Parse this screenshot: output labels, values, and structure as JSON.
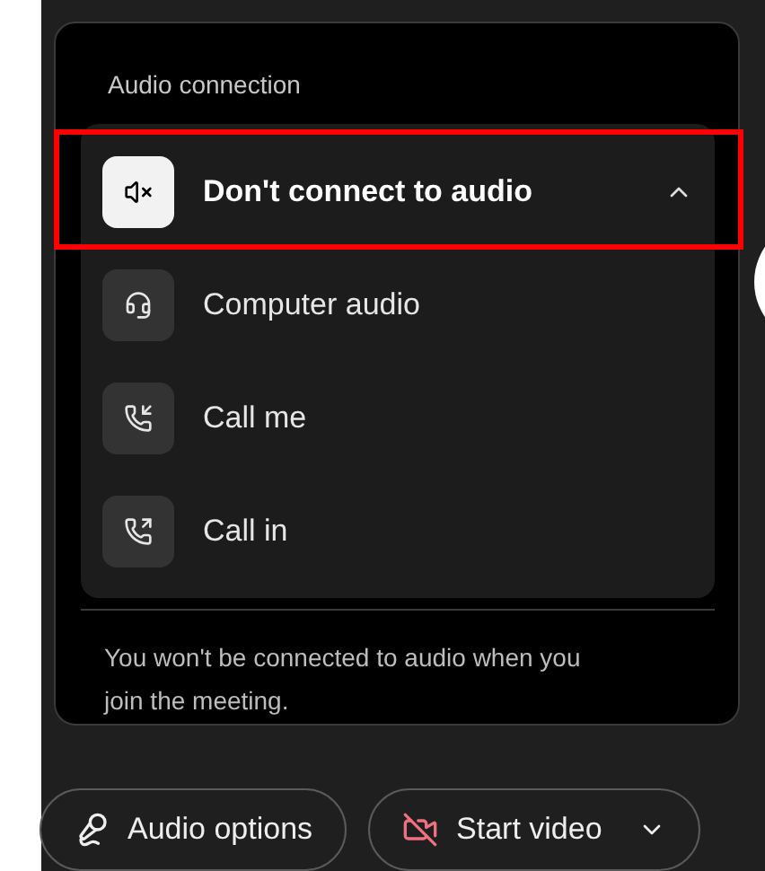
{
  "audio_connection": {
    "heading": "Audio connection",
    "expanded": true,
    "options": [
      {
        "kind": "mute",
        "label": "Don't connect to audio",
        "selected": true
      },
      {
        "kind": "headset",
        "label": "Computer audio",
        "selected": false
      },
      {
        "kind": "call_me",
        "label": "Call me",
        "selected": false
      },
      {
        "kind": "call_in",
        "label": "Call in",
        "selected": false
      }
    ],
    "note": "You won't be connected to audio when you join the meeting."
  },
  "toolbar": [
    {
      "kind": "audio",
      "label": "Audio options",
      "menu": false
    },
    {
      "kind": "video",
      "label": "Start video",
      "menu": true
    }
  ]
}
